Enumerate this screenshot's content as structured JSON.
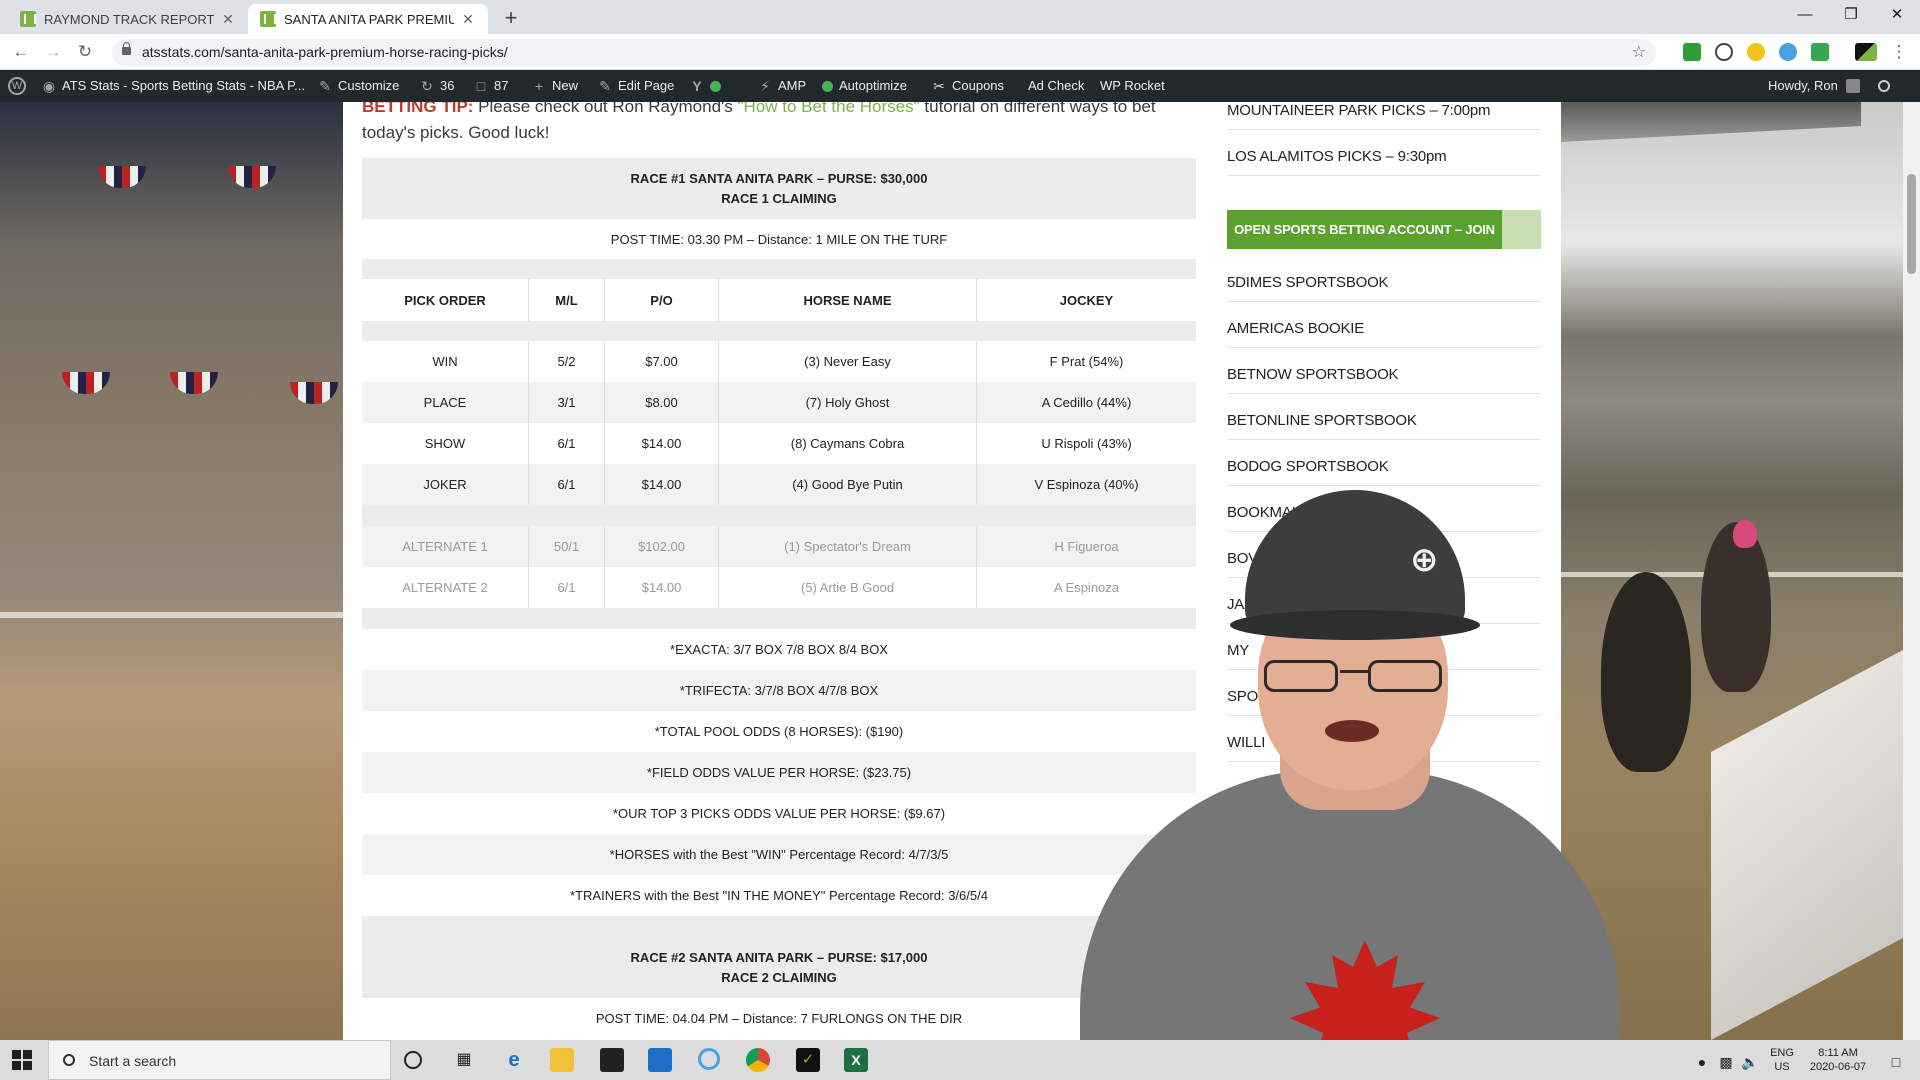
{
  "browser": {
    "tabs": [
      {
        "title": "RAYMOND TRACK REPORT FREE",
        "active": false
      },
      {
        "title": "SANTA ANITA PARK PREMIUM H",
        "active": true
      }
    ],
    "url": "atsstats.com/santa-anita-park-premium-horse-racing-picks/"
  },
  "wpbar": {
    "site": "ATS Stats - Sports Betting Stats - NBA P...",
    "customize": "Customize",
    "updates": "36",
    "comments": "87",
    "new": "New",
    "edit_page": "Edit Page",
    "amp": "AMP",
    "autoptimize": "Autoptimize",
    "coupons": "Coupons",
    "ad_check": "Ad Check",
    "wp_rocket": "WP Rocket",
    "howdy": "Howdy, Ron"
  },
  "intro": {
    "lead": "BETTING TIP:",
    "text1": " Please check out Ron Raymond's ",
    "link": "\"How to Bet the Horses\"",
    "text2": " tutorial on different ways to bet today's picks. Good luck!"
  },
  "race1": {
    "title": "RACE #1 SANTA ANITA PARK – PURSE: $30,000",
    "subtitle": "RACE 1 CLAIMING",
    "post_time": "POST TIME: 03.30 PM – Distance: 1 MILE ON THE TURF",
    "headers": [
      "PICK ORDER",
      "M/L",
      "P/O",
      "HORSE NAME",
      "JOCKEY"
    ],
    "rows": [
      [
        "WIN",
        "5/2",
        "$7.00",
        "(3) Never Easy",
        "F Prat (54%)"
      ],
      [
        "PLACE",
        "3/1",
        "$8.00",
        "(7) Holy Ghost",
        "A Cedillo (44%)"
      ],
      [
        "SHOW",
        "6/1",
        "$14.00",
        "(8) Caymans Cobra",
        "U Rispoli (43%)"
      ],
      [
        "JOKER",
        "6/1",
        "$14.00",
        "(4) Good Bye Putin",
        "V Espinoza (40%)"
      ]
    ],
    "alternates": [
      [
        "ALTERNATE 1",
        "50/1",
        "$102.00",
        "(1) Spectator's Dream",
        "H Figueroa"
      ],
      [
        "ALTERNATE 2",
        "6/1",
        "$14.00",
        "(5) Artie B Good",
        "A Espinoza"
      ]
    ],
    "notes": [
      "*EXACTA: 3/7 BOX 7/8 BOX 8/4 BOX",
      "*TRIFECTA: 3/7/8 BOX 4/7/8 BOX",
      "*TOTAL POOL ODDS (8 HORSES): ($190)",
      "*FIELD ODDS VALUE PER HORSE: ($23.75)",
      "*OUR TOP 3 PICKS ODDS VALUE PER HORSE: ($9.67)",
      "*HORSES with the Best \"WIN\" Percentage Record: 4/7/3/5",
      "*TRAINERS with the Best \"IN THE MONEY\" Percentage Record: 3/6/5/4"
    ]
  },
  "race2": {
    "title": "RACE #2 SANTA ANITA PARK – PURSE: $17,000",
    "subtitle": "RACE 2 CLAIMING",
    "post_time": "POST TIME: 04.04 PM – Distance: 7 FURLONGS ON THE DIR"
  },
  "sidebar": {
    "links_top": [
      "MOUNTAINEER PARK PICKS – 7:00pm",
      "LOS ALAMITOS PICKS – 9:30pm"
    ],
    "join_label": "OPEN SPORTS BETTING ACCOUNT – JOIN NOW!",
    "books": [
      "5DIMES SPORTSBOOK",
      "AMERICAS BOOKIE",
      "BETNOW SPORTSBOOK",
      "BETONLINE SPORTSBOOK",
      "BODOG SPORTSBOOK",
      "BOOKMAK",
      "BOVAD",
      "JAZZ",
      "MY",
      "SPO",
      "WILLI"
    ]
  },
  "taskbar": {
    "search_placeholder": "Start a search",
    "lang": "ENG",
    "region": "US",
    "time": "8:11 AM",
    "date": "2020-06-07"
  },
  "colors": {
    "accent_green": "#5aa12e",
    "wp_bar": "#23282d",
    "tip_red": "#c0392b"
  }
}
